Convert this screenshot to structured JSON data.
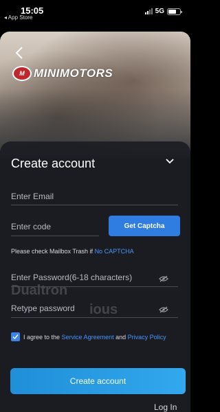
{
  "status_bar": {
    "time": "15:05",
    "back_app": "◂ App Store",
    "network": "5G",
    "battery_percent": 70
  },
  "hero": {
    "logo_badge": "M",
    "logo_text": "MINIMOTORS",
    "ghost_brand": "Dualtron",
    "ghost_line": "ious"
  },
  "sheet": {
    "title": "Create account",
    "email_placeholder": "Enter Email",
    "code_placeholder": "Enter code",
    "captcha_button": "Get Captcha",
    "mailbox_note_prefix": "Please check Mailbox Trash if ",
    "mailbox_note_link": "No CAPTCHA",
    "password_placeholder": "Enter Password(6-18 characters)",
    "retype_placeholder": "Retype password",
    "agree_checked": true,
    "agree_prefix": "I agree to the ",
    "agree_service": "Service Agreement",
    "agree_and": " and ",
    "agree_privacy": "Privacy Policy",
    "create_button": "Create account",
    "login_link": "Log In"
  },
  "colors": {
    "accent": "#2f7de1",
    "link": "#4a95ff",
    "sheet_bg": "#1c1e24"
  }
}
